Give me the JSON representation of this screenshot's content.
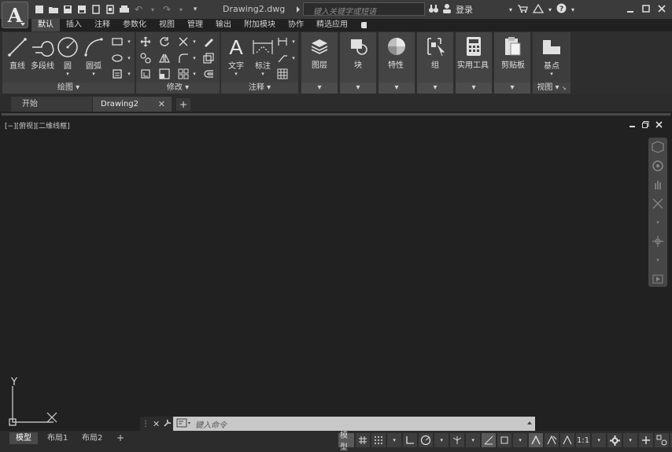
{
  "titlebar": {
    "doc_title": "Drawing2.dwg",
    "search_placeholder": "键入关键字或短语",
    "login_label": "登录"
  },
  "ribbon_tabs": [
    "默认",
    "插入",
    "注释",
    "参数化",
    "视图",
    "管理",
    "输出",
    "附加模块",
    "协作",
    "精选应用"
  ],
  "panels": {
    "draw": {
      "title": "绘图",
      "line": "直线",
      "polyline": "多段线",
      "circle": "圆",
      "arc": "圆弧"
    },
    "modify": {
      "title": "修改"
    },
    "annotation": {
      "title": "注释",
      "text": "文字",
      "dimension": "标注"
    },
    "layers": "图层",
    "block": "块",
    "properties": "特性",
    "groups": "组",
    "utilities": "实用工具",
    "clipboard": "剪贴板",
    "view": {
      "title": "视图",
      "base": "基点"
    }
  },
  "doc_tabs": [
    "开始",
    "Drawing2"
  ],
  "viewport_label": "[−][俯视][二维线框]",
  "ucs": {
    "x": "X",
    "y": "Y"
  },
  "command_placeholder": "键入命令",
  "layout_tabs": [
    "模型",
    "布局1",
    "布局2"
  ],
  "status": {
    "model": "模型",
    "scale": "1:1"
  },
  "colors": {
    "background": "#212121",
    "ribbon": "#3d3d3d",
    "titlebar": "#3b3b3b"
  }
}
